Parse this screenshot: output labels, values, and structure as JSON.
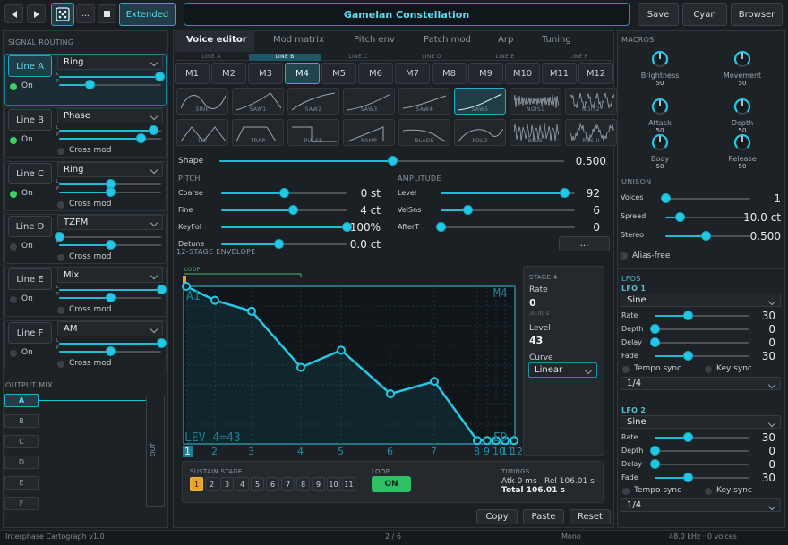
{
  "toolbar": {
    "extended_label": "Extended",
    "more_label": "...",
    "preset_name": "Gamelan Constellation",
    "save_label": "Save",
    "theme_label": "Cyan",
    "browser_label": "Browser"
  },
  "routing": {
    "title": "SIGNAL ROUTING",
    "on_label": "On",
    "crossmod_label": "Cross mod",
    "lines": [
      {
        "name": "Line A",
        "mode": "Ring",
        "on": true
      },
      {
        "name": "Line B",
        "mode": "Phase",
        "on": true
      },
      {
        "name": "Line C",
        "mode": "Ring",
        "on": true
      },
      {
        "name": "Line D",
        "mode": "TZFM",
        "on": false
      },
      {
        "name": "Line E",
        "mode": "Mix",
        "on": false
      },
      {
        "name": "Line F",
        "mode": "AM",
        "on": false
      }
    ]
  },
  "output_mix": {
    "title": "OUTPUT MIX",
    "buttons": [
      "A",
      "B",
      "C",
      "D",
      "E",
      "F"
    ],
    "out_label": "OUT"
  },
  "tabs": [
    "Voice editor",
    "Mod matrix",
    "Pitch env",
    "Patch mod",
    "Arp",
    "Tuning"
  ],
  "line_tabs": [
    "LINE A",
    "LINE B",
    "LINE C",
    "LINE D",
    "LINE E",
    "LINE F"
  ],
  "modules": [
    "M1",
    "M2",
    "M3",
    "M4",
    "M5",
    "M6",
    "M7",
    "M8",
    "M9",
    "M10",
    "M11",
    "M12"
  ],
  "waves": [
    "SINE",
    "SAW1",
    "SAW2",
    "SAW3",
    "SAW4",
    "SAW5",
    "NOIS1",
    "NOIS2",
    "TRI",
    "TRAP",
    "PULSE",
    "RAMP",
    "BLADE",
    "FOLD",
    "BLUE",
    "RES-II"
  ],
  "shape": {
    "label": "Shape",
    "value": "0.500"
  },
  "pitch": {
    "title": "PITCH",
    "rows": [
      {
        "label": "Coarse",
        "value": "0 st"
      },
      {
        "label": "Fine",
        "value": "4 ct"
      },
      {
        "label": "KeyFol",
        "value": "100%"
      },
      {
        "label": "Detune",
        "value": "0.0 ct"
      }
    ]
  },
  "amplitude": {
    "title": "AMPLITUDE",
    "rows": [
      {
        "label": "Level",
        "value": "92"
      },
      {
        "label": "VelSns",
        "value": "6"
      },
      {
        "label": "AfterT",
        "value": "0"
      }
    ],
    "more_label": "..."
  },
  "envelope": {
    "title": "12-STAGE ENVELOPE",
    "loop_label": "LOOP",
    "module_tag": "M4",
    "corner_label": "A1",
    "readout": "LEV 4=43",
    "end_label": "ED",
    "stage_numbers": [
      "1",
      "2",
      "3",
      "4",
      "5",
      "6",
      "7",
      "8",
      "9",
      "10",
      "11",
      "12"
    ],
    "points": [
      100,
      91,
      84,
      48,
      59,
      31,
      39,
      1,
      1,
      1,
      1,
      1
    ]
  },
  "stage": {
    "title": "STAGE 4",
    "rate_label": "Rate",
    "rate_value": "0",
    "rate_sub": "30.00 s",
    "level_label": "Level",
    "level_value": "43",
    "curve_label": "Curve",
    "curve_value": "Linear"
  },
  "sustain": {
    "title": "SUSTAIN STAGE",
    "stages": [
      "1",
      "2",
      "3",
      "4",
      "5",
      "6",
      "7",
      "8",
      "9",
      "10",
      "11"
    ],
    "active": "1"
  },
  "loop": {
    "title": "LOOP",
    "value": "ON"
  },
  "timings": {
    "title": "TIMINGS",
    "atk": "Atk 0 ms",
    "rel": "Rel 106.01 s",
    "total": "Total 106.01 s"
  },
  "edit": {
    "copy": "Copy",
    "paste": "Paste",
    "reset": "Reset"
  },
  "macros": {
    "title": "MACROS",
    "items": [
      {
        "label": "Brightness",
        "value": "50"
      },
      {
        "label": "Movement",
        "value": "50"
      },
      {
        "label": "Attack",
        "value": "50"
      },
      {
        "label": "Depth",
        "value": "50"
      },
      {
        "label": "Body",
        "value": "50"
      },
      {
        "label": "Release",
        "value": "50"
      }
    ]
  },
  "unison": {
    "title": "UNISON",
    "rows": [
      {
        "label": "Voices",
        "value": "1"
      },
      {
        "label": "Spread",
        "value": "10.0 ct"
      },
      {
        "label": "Stereo",
        "value": "0.500"
      }
    ],
    "alias_label": "Alias-free"
  },
  "lfos": {
    "title": "LFOS",
    "items": [
      {
        "name": "LFO 1",
        "wave": "Sine",
        "rows": [
          {
            "label": "Rate",
            "value": "30"
          },
          {
            "label": "Depth",
            "value": "0"
          },
          {
            "label": "Delay",
            "value": "0"
          },
          {
            "label": "Fade",
            "value": "30"
          }
        ],
        "tempo_label": "Tempo sync",
        "key_label": "Key sync",
        "division": "1/4"
      },
      {
        "name": "LFO 2",
        "wave": "Sine",
        "rows": [
          {
            "label": "Rate",
            "value": "30"
          },
          {
            "label": "Depth",
            "value": "0"
          },
          {
            "label": "Delay",
            "value": "0"
          },
          {
            "label": "Fade",
            "value": "30"
          }
        ],
        "tempo_label": "Tempo sync",
        "key_label": "Key sync",
        "division": "1/4"
      }
    ]
  },
  "status": {
    "product": "Interphase Cartograph v1.0",
    "page": "2 / 6",
    "mode": "Mono",
    "engine": "48.0 kHz · 0 voices"
  },
  "colors": {
    "accent": "#1fbcd6",
    "on_green": "#3fcf6a",
    "sustain_orange": "#e9a326"
  }
}
